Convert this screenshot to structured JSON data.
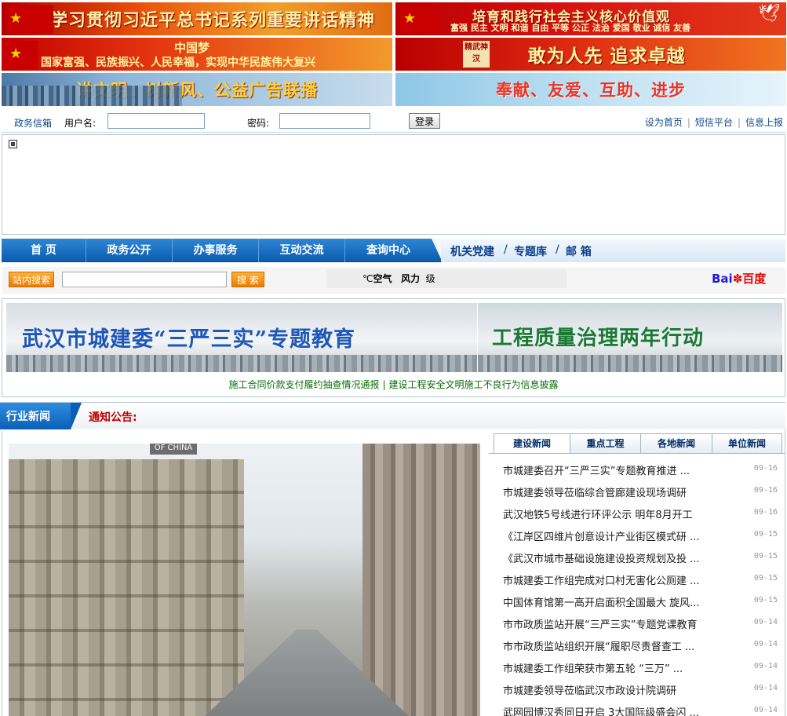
{
  "banners": {
    "b1": "学习贯彻习近平总书记系列重要讲话精神",
    "b2_title": "培育和践行社会主义核心价值观",
    "b2_sub": "富强 民主 文明 和谐  自由 平等 公正 法治  爱国 敬业 诚信 友善",
    "b3_title": "中国梦",
    "b3_sub": "国家富强、民族振兴、人民幸福，实现中华民族伟大复兴",
    "b4_seal": "精武神汉",
    "b4_title": "敢为人先  追求卓越",
    "b5": "讲文明、树新风、公益广告联播",
    "b6": "奉献、友爱、互助、进步"
  },
  "login": {
    "mailbox_label": "政务信箱",
    "username_label": "用户名:",
    "username_value": "",
    "password_label": "密码:",
    "password_value": "",
    "login_button": "登录"
  },
  "toplinks": [
    "设为首页",
    "短信平台",
    "信息上报"
  ],
  "nav": {
    "items": [
      "首 页",
      "政务公开",
      "办事服务",
      "互动交流",
      "查询中心"
    ],
    "extra": [
      "机关党建",
      "专题库",
      "邮 箱"
    ]
  },
  "search": {
    "site_search_label": "站内搜索",
    "query": "",
    "search_button": "搜 索",
    "weather_temp": "℃",
    "weather_air": "空气",
    "weather_wind": "风力",
    "weather_level": "级",
    "baidu_text": "Bai",
    "baidu_text2": "百度"
  },
  "feature": {
    "left_title": "武汉市城建委“三严三实”专题教育",
    "right_title": "工程质量治理两年行动",
    "links": [
      "施工合同价款支付履约抽查情况通报",
      "建设工程安全文明施工不良行为信息披露"
    ]
  },
  "news": {
    "section_title": "行业新闻",
    "notice_label": "通知公告:",
    "tabs": [
      "建设新闻",
      "重点工程",
      "各地新闻",
      "单位新闻"
    ],
    "items": [
      {
        "title": "市城建委召开“三严三实”专题教育推进 ...",
        "date": "09-16"
      },
      {
        "title": "市城建委领导莅临综合管廊建设现场调研",
        "date": "09-16"
      },
      {
        "title": "武汉地铁5号线进行环评公示 明年8月开工",
        "date": "09-16"
      },
      {
        "title": "《江岸区四维片创意设计产业街区模式研 ...",
        "date": "09-15"
      },
      {
        "title": "《武汉市城市基础设施建设投资规划及投 ...",
        "date": "09-15"
      },
      {
        "title": "市城建委工作组完成对口村无害化公厕建 ...",
        "date": "09-15"
      },
      {
        "title": "中国体育馆第一高开启面积全国最大 旋风...",
        "date": "09-15"
      },
      {
        "title": "市市政质监站开展“三严三实”专题党课教育",
        "date": "09-14"
      },
      {
        "title": "市市政质监站组织开展“履职尽责督查工 ...",
        "date": "09-14"
      },
      {
        "title": "市城建委工作组荣获市第五轮 “三万” ...",
        "date": "09-14"
      },
      {
        "title": "市城建委领导莅临武汉市政设计院调研",
        "date": "09-14"
      },
      {
        "title": "武网园博汉秀同日开启 3大国际级盛会闪 ...",
        "date": "09-14"
      }
    ]
  },
  "photo": {
    "sign_text": "OF CHINA"
  }
}
